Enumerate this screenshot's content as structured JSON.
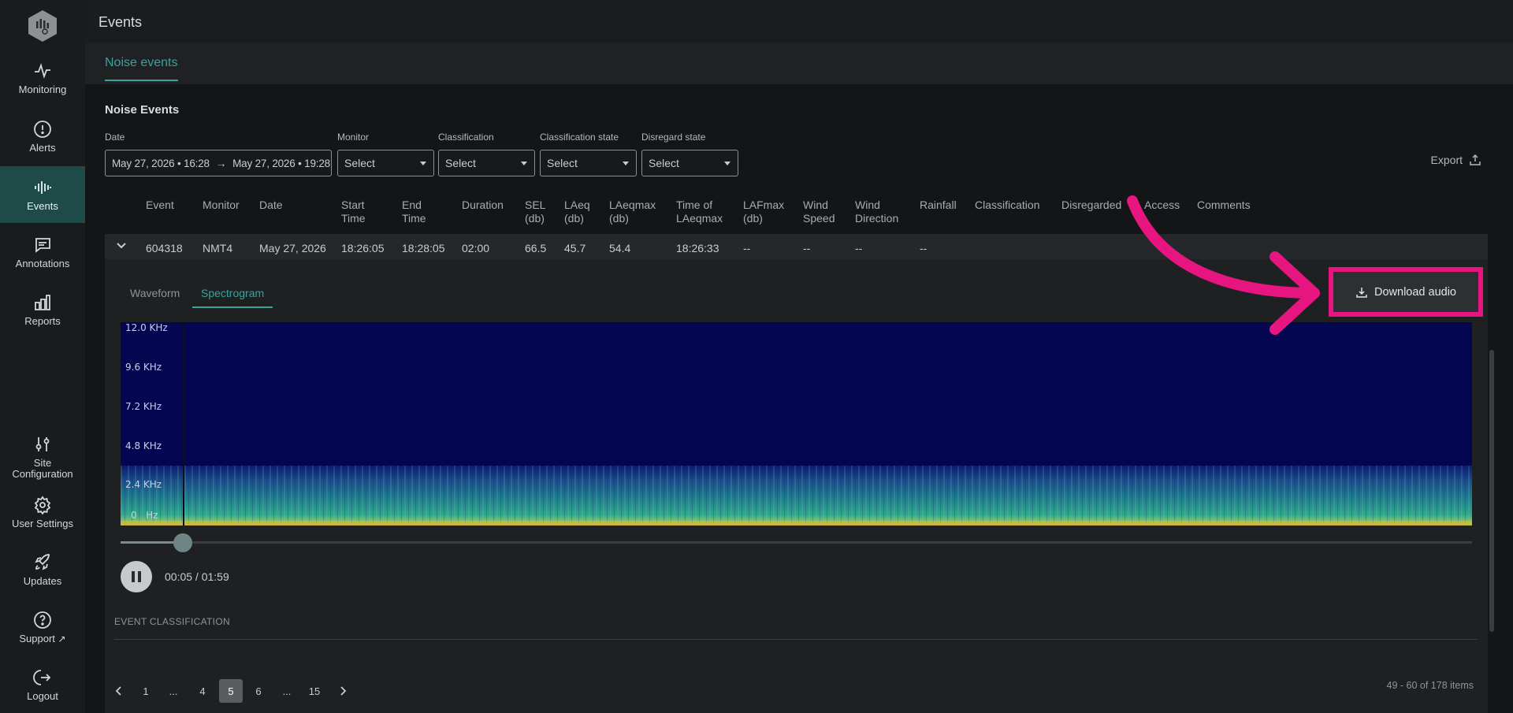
{
  "app": {
    "header_title": "Events",
    "tab_label": "Noise events"
  },
  "sidebar": {
    "items": [
      {
        "label": "Monitoring",
        "icon": "activity-icon"
      },
      {
        "label": "Alerts",
        "icon": "alert-circle-icon"
      },
      {
        "label": "Events",
        "icon": "waveform-icon",
        "active": true
      },
      {
        "label": "Annotations",
        "icon": "message-square-icon"
      },
      {
        "label": "Reports",
        "icon": "bar-chart-icon"
      },
      {
        "label": "Site\nConfiguration",
        "icon": "sliders-icon"
      },
      {
        "label": "User Settings",
        "icon": "gear-icon"
      },
      {
        "label": "Updates",
        "icon": "rocket-icon"
      },
      {
        "label": "Support",
        "icon": "help-circle-icon"
      },
      {
        "label": "Logout",
        "icon": "logout-icon"
      }
    ]
  },
  "main": {
    "section_title": "Noise Events",
    "filters": {
      "date_label": "Date",
      "date_from": "May 27, 2026 • 16:28",
      "date_to": "May 27, 2026 • 19:28",
      "monitor_label": "Monitor",
      "monitor_value": "Select",
      "classification_label": "Classification",
      "classification_value": "Select",
      "classification_state_label": "Classification state",
      "classification_state_value": "Select",
      "disregard_state_label": "Disregard state",
      "disregard_state_value": "Select"
    },
    "export_label": "Export",
    "table": {
      "columns": [
        "Event",
        "Monitor",
        "Date",
        "Start\nTime",
        "End\nTime",
        "Duration",
        "SEL\n(db)",
        "LAeq\n(db)",
        "LAeqmax\n(db)",
        "Time of\nLAeqmax",
        "LAFmax\n(db)",
        "Wind\nSpeed",
        "Wind\nDirection",
        "Rainfall",
        "Classification",
        "Disregarded",
        "Access",
        "Comments"
      ],
      "row": [
        "604318",
        "NMT4",
        "May 27, 2026",
        "18:26:05",
        "18:28:05",
        "02:00",
        "66.5",
        "45.7",
        "54.4",
        "18:26:33",
        "--",
        "--",
        "--",
        "--"
      ]
    },
    "detail": {
      "tabs": [
        "Waveform",
        "Spectrogram"
      ],
      "active_tab": "Spectrogram",
      "download_label": "Download audio",
      "freq_labels": [
        "12.0 KHz",
        "9.6 KHz",
        "7.2 KHz",
        "4.8 KHz",
        "2.4 KHz",
        "0   Hz"
      ],
      "progress": 0.042,
      "time": "00:05 / 01:59",
      "classification_section": "EVENT CLASSIFICATION"
    },
    "pagination": {
      "pages": [
        "1",
        "...",
        "4",
        "5",
        "6",
        "...",
        "15"
      ],
      "current": "5",
      "info": "49 - 60 of 178 items"
    }
  },
  "colors": {
    "accent": "#3aa39a",
    "highlight": "#e7157f",
    "active_nav": "#1e4a47"
  }
}
